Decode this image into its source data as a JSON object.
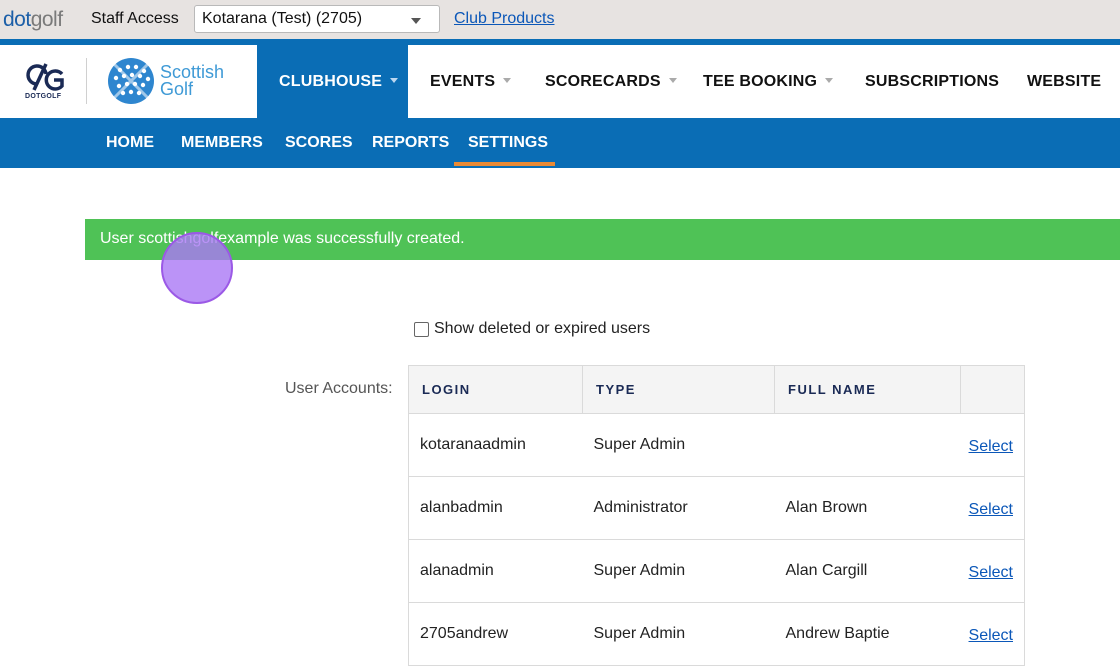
{
  "topbar": {
    "logo_main": "dot",
    "logo_light": "golf",
    "staff_label": "Staff Access",
    "club_selected": "Kotarana (Test) (2705)",
    "club_products_link": "Club Products"
  },
  "brand": {
    "dotgolf_mark_text": "DOTGOLF",
    "scottish_golf_line1": "Scottish",
    "scottish_golf_line2": "Golf",
    "accent_color": "#0a6db5",
    "highlight_color": "#e98a35"
  },
  "main_nav": [
    {
      "label": "CLUBHOUSE",
      "dropdown": true,
      "active": true
    },
    {
      "label": "EVENTS",
      "dropdown": true
    },
    {
      "label": "SCORECARDS",
      "dropdown": true
    },
    {
      "label": "TEE BOOKING",
      "dropdown": true
    },
    {
      "label": "SUBSCRIPTIONS",
      "dropdown": false
    },
    {
      "label": "WEBSITE",
      "dropdown": false
    }
  ],
  "sub_nav": [
    {
      "label": "HOME"
    },
    {
      "label": "MEMBERS"
    },
    {
      "label": "SCORES"
    },
    {
      "label": "REPORTS"
    },
    {
      "label": "SETTINGS",
      "active": true
    }
  ],
  "alert": {
    "message": "User scottishgolfexample was successfully created.",
    "color": "#4fc256"
  },
  "filters": {
    "show_deleted_label": "Show deleted or expired users",
    "show_deleted_checked": false
  },
  "accounts": {
    "label": "User Accounts:",
    "columns": [
      "LOGIN",
      "TYPE",
      "FULL NAME",
      ""
    ],
    "rows": [
      {
        "login": "kotaranaadmin",
        "type": "Super Admin",
        "full_name": "",
        "action": "Select"
      },
      {
        "login": "alanbadmin",
        "type": "Administrator",
        "full_name": "Alan Brown",
        "action": "Select"
      },
      {
        "login": "alanadmin",
        "type": "Super Admin",
        "full_name": "Alan Cargill",
        "action": "Select"
      },
      {
        "login": "2705andrew",
        "type": "Super Admin",
        "full_name": "Andrew Baptie",
        "action": "Select"
      }
    ]
  }
}
